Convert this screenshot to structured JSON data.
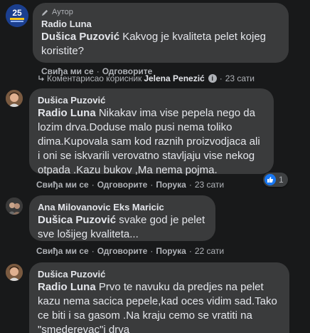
{
  "comments": [
    {
      "author_badge": "Аутор",
      "author": "Radio Luna",
      "mention": "Dušica Puzović",
      "text": " Kakvog je kvaliteta pelet kojeg koristite?",
      "like": "Свиђа ми се",
      "reply": "Одговорите",
      "replied_note": "Коментарисао корисник",
      "replied_by": "Jelena Penezić",
      "time": "23 сати",
      "avatar_label": "25"
    },
    {
      "author": "Dušica Puzović",
      "mention": "Radio Luna",
      "text": " Nikakav ima vise pepela nego da lozim drva.Doduse malo pusi nema toliko dima.Kupovala sam kod raznih proizvodjaca ali i oni se iskvarili verovatno stavljaju vise nekog otpada .Kazu bukov ,Ma nema pojma.",
      "like": "Свиђа ми се",
      "reply": "Одговорите",
      "share": "Порука",
      "time": "23 сати",
      "reaction_count": "1"
    },
    {
      "author": "Ana Milovanovic Eks Maricic",
      "mention": "Dušica Puzović",
      "text": " svake god je pelet sve lošijeg kvaliteta...",
      "like": "Свиђа ми се",
      "reply": "Одговорите",
      "share": "Порука",
      "time": "22 сати"
    },
    {
      "author": "Dušica Puzović",
      "mention": "Radio Luna",
      "text": " Prvo te navuku da predjes na pelet kazu nema sacica pepele,kad oces vidim sad.Tako ce biti i sa gasom .Na kraju cemo se vratiti na \"smederevac\"i drva"
    }
  ],
  "colors": {
    "background": "#18191a",
    "bubble": "#3a3b3c",
    "text": "#e4e6eb",
    "secondary": "#b0b3b8",
    "like_blue": "#1877f2"
  }
}
